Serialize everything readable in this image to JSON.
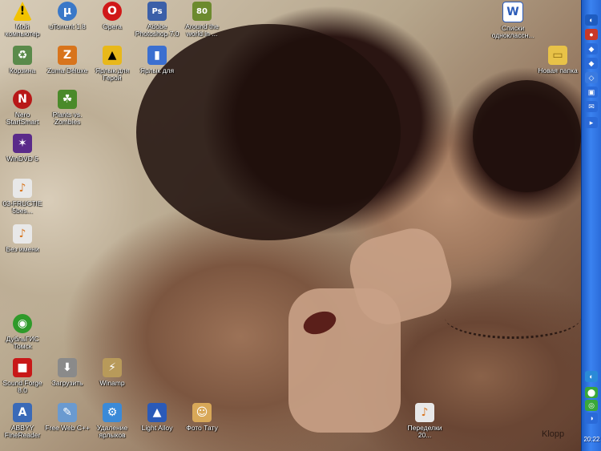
{
  "desktop_icons": [
    {
      "id": "my-computer",
      "label": "Мой компьютер",
      "icon": "warning-triangle-icon",
      "color": "#f2c200",
      "glyph": "!"
    },
    {
      "id": "utorrent",
      "label": "uTorrent 1.8",
      "icon": "utorrent-icon",
      "color": "#3a78c8",
      "glyph": "µ"
    },
    {
      "id": "opera",
      "label": "Opera",
      "icon": "opera-icon",
      "color": "#d01818",
      "glyph": "O"
    },
    {
      "id": "photoshop",
      "label": "Adobe Photoshop 7.0",
      "icon": "photoshop-icon",
      "color": "#3b5fa8",
      "glyph": "Ps"
    },
    {
      "id": "around-world",
      "label": "Around the world in ...",
      "icon": "game-80-icon",
      "color": "#6c8a2e",
      "glyph": "80"
    },
    {
      "id": "word-doc",
      "label": "Списки одноклассн...",
      "icon": "word-document-icon",
      "color": "#2a5bb8",
      "glyph": "W"
    },
    {
      "id": "recycle-bin",
      "label": "Корзина",
      "icon": "recycle-bin-icon",
      "color": "#5a8a4a",
      "glyph": "♻"
    },
    {
      "id": "zuma",
      "label": "Zuma Deluxe",
      "icon": "zuma-icon",
      "color": "#d8741c",
      "glyph": "Z"
    },
    {
      "id": "hero-shortcut",
      "label": "Ярлык для Герой",
      "icon": "shortcut-icon",
      "color": "#e8b81a",
      "glyph": "▲"
    },
    {
      "id": "nero-or",
      "label": "Ярлык для",
      "icon": "shortcut-blue-icon",
      "color": "#3b6fd0",
      "glyph": "▮"
    },
    {
      "id": "new-folder",
      "label": "Новая папка",
      "icon": "folder-icon",
      "color": "#e8c248",
      "glyph": "▭"
    },
    {
      "id": "nero",
      "label": "Nero StartSmart",
      "icon": "nero-icon",
      "color": "#b81818",
      "glyph": "N"
    },
    {
      "id": "plants",
      "label": "Plants vs. Zombies",
      "icon": "plants-zombies-icon",
      "color": "#4a8a2a",
      "glyph": "☘"
    },
    {
      "id": "windvd",
      "label": "WinDVD 5",
      "icon": "windvd-icon",
      "color": "#5a2a8a",
      "glyph": "✶"
    },
    {
      "id": "file-03",
      "label": "03-FRUCTIE 5bes...",
      "icon": "media-file-icon",
      "color": "#e8e8e8",
      "glyph": "♪"
    },
    {
      "id": "file-bg",
      "label": "Без имени",
      "icon": "media-file-icon",
      "color": "#e8e8e8",
      "glyph": "♪"
    },
    {
      "id": "mccafe",
      "label": "ДубльГИС Томск",
      "icon": "dublgis-icon",
      "color": "#2f9a2a",
      "glyph": "◉"
    },
    {
      "id": "soundforge",
      "label": "Sound Forge 8.0",
      "icon": "soundforge-icon",
      "color": "#c81818",
      "glyph": "■"
    },
    {
      "id": "downloads",
      "label": "Загрузить",
      "icon": "downloads-icon",
      "color": "#8a8a8a",
      "glyph": "⬇"
    },
    {
      "id": "winamp",
      "label": "Winamp",
      "icon": "winamp-icon",
      "color": "#b89a5a",
      "glyph": "⚡"
    },
    {
      "id": "abbyy",
      "label": "ABBYY FineReader",
      "icon": "abbyy-icon",
      "color": "#3a6ab8",
      "glyph": "A"
    },
    {
      "id": "feewe",
      "label": "Free Web C++",
      "icon": "feewe-icon",
      "color": "#6a9ad0",
      "glyph": "✎"
    },
    {
      "id": "remote",
      "label": "Удаление ярлыков",
      "icon": "remote-icon",
      "color": "#3a8ad8",
      "glyph": "⚙"
    },
    {
      "id": "light-alloy",
      "label": "Light Alloy",
      "icon": "light-alloy-icon",
      "color": "#2a5ab8",
      "glyph": "▲"
    },
    {
      "id": "photo-tattoo",
      "label": "Фото Тату",
      "icon": "tattoo-icon",
      "color": "#d8a858",
      "glyph": "☺"
    },
    {
      "id": "txt-file",
      "label": "Переделки 20...",
      "icon": "media-file-icon",
      "color": "#e8e8e8",
      "glyph": "♪"
    }
  ],
  "sidebar": {
    "buttons": [
      "quick-1",
      "quick-2",
      "quick-3",
      "quick-4",
      "quick-5",
      "quick-6",
      "quick-7",
      "quick-8"
    ],
    "clock": "20:22"
  },
  "watermark": "Klopp"
}
